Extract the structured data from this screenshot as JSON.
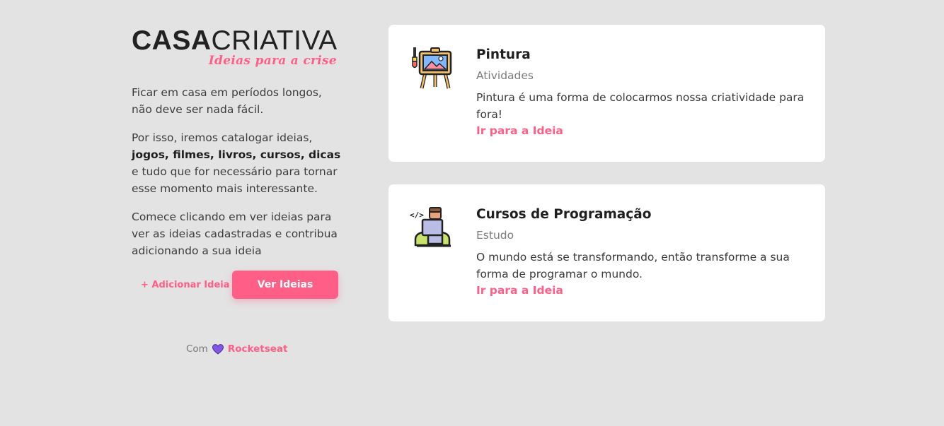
{
  "brand": {
    "logo_bold": "CASA",
    "logo_light": "CRIATIVA",
    "tagline": "Ideias para a crise"
  },
  "intro": {
    "p1": "Ficar em casa em períodos longos, não deve ser nada fácil.",
    "p2_before": "Por isso, iremos catalogar ideias,",
    "p2_bold": "jogos, filmes, livros, cursos, dicas",
    "p2_after": "e tudo que for necessário para tornar esse momento mais interessante.",
    "p3": "Comece clicando em ver ideias para ver as ideias cadastradas e contribua adicionando a sua ideia"
  },
  "actions": {
    "add_label": "+ Adicionar Ideia",
    "view_label": "Ver Ideias"
  },
  "footer": {
    "prefix": "Com",
    "heart_icon": "heart-icon",
    "brand": "Rocketseat"
  },
  "colors": {
    "accent": "#ff5e87",
    "background": "#e3e3e3",
    "card": "#ffffff",
    "heart": "#8257e5"
  },
  "ideas": [
    {
      "icon": "painting-easel-icon",
      "title": "Pintura",
      "category": "Atividades",
      "description": "Pintura é uma forma de colocarmos nossa criatividade para fora!",
      "link": "Ir para a Ideia"
    },
    {
      "icon": "programmer-laptop-icon",
      "title": "Cursos de Programação",
      "category": "Estudo",
      "description": "O mundo está se transformando, então transforme a sua forma de programar o mundo.",
      "link": "Ir para a Ideia"
    }
  ]
}
